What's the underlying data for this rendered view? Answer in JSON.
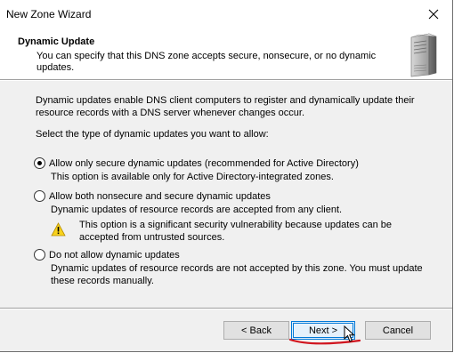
{
  "window": {
    "title": "New Zone Wizard"
  },
  "header": {
    "title": "Dynamic Update",
    "description": "You can specify that this DNS zone accepts secure, nonsecure, or no dynamic updates."
  },
  "content": {
    "intro": "Dynamic updates enable DNS client computers to register and dynamically update their resource records with a DNS server whenever changes occur.",
    "prompt": "Select the type of dynamic updates you want to allow:",
    "options": [
      {
        "label": "Allow only secure dynamic updates (recommended for Active Directory)",
        "description": "This option is available only for Active Directory-integrated zones.",
        "selected": true
      },
      {
        "label": "Allow both nonsecure and secure dynamic updates",
        "description": "Dynamic updates of resource records are accepted from any client.",
        "warning": "This option is a significant security vulnerability because updates can be accepted from untrusted sources.",
        "selected": false
      },
      {
        "label": "Do not allow dynamic updates",
        "description": "Dynamic updates of resource records are not accepted by this zone. You must update these records manually.",
        "selected": false
      }
    ]
  },
  "buttons": {
    "back": "< Back",
    "next": "Next >",
    "cancel": "Cancel"
  },
  "icons": {
    "close": "close-icon",
    "server": "server-icon",
    "warning": "warning-icon",
    "cursor": "mouse-cursor-icon"
  },
  "colors": {
    "focus_border": "#0078d7",
    "annotation": "#d0141e",
    "warning_fill": "#f8d21c"
  }
}
